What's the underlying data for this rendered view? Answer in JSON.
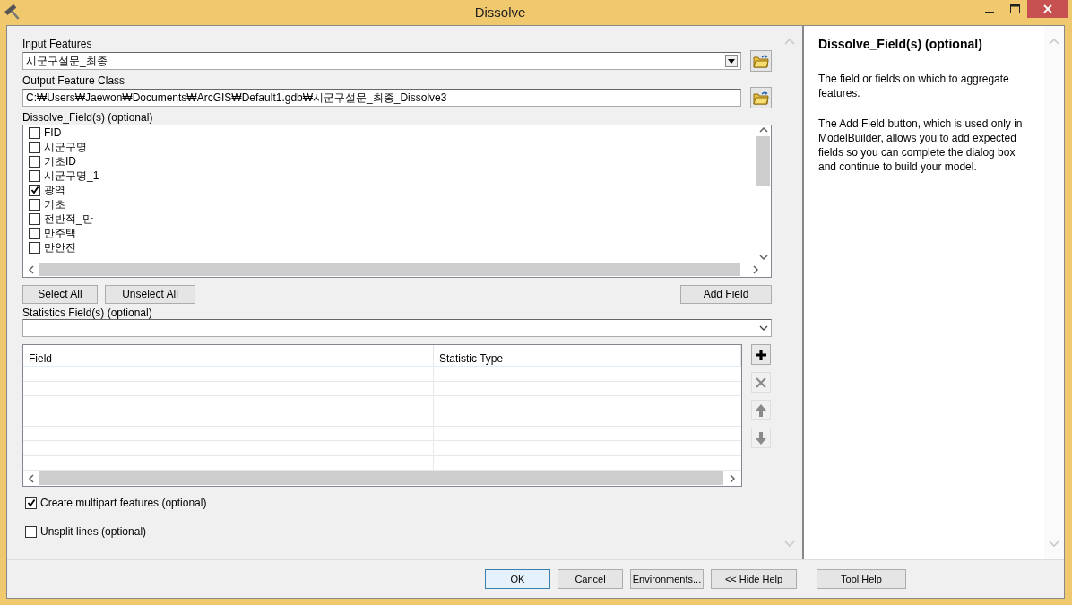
{
  "window": {
    "title": "Dissolve"
  },
  "input_features": {
    "label": "Input Features",
    "value": "시군구설문_최종"
  },
  "output_feature_class": {
    "label": "Output Feature Class",
    "value": "C:₩Users₩Jaewon₩Documents₩ArcGIS₩Default1.gdb₩시군구설문_최종_Dissolve3"
  },
  "dissolve_fields": {
    "label": "Dissolve_Field(s) (optional)",
    "items": [
      {
        "label": "FID",
        "checked": false
      },
      {
        "label": "시군구명",
        "checked": false
      },
      {
        "label": "기초ID",
        "checked": false
      },
      {
        "label": "시군구명_1",
        "checked": false
      },
      {
        "label": "광역",
        "checked": true
      },
      {
        "label": "기초",
        "checked": false
      },
      {
        "label": "전반적_만",
        "checked": false
      },
      {
        "label": "만주택",
        "checked": false
      },
      {
        "label": "만안전",
        "checked": false
      }
    ]
  },
  "list_buttons": [
    "Select All",
    "Unselect All"
  ],
  "add_field_button": "Add Field",
  "statistics_fields": {
    "label": "Statistics Field(s) (optional)",
    "columns": [
      "Field",
      "Statistic Type"
    ],
    "tools": [
      {
        "kind": "add",
        "disabled": false
      },
      {
        "kind": "remove",
        "disabled": true
      },
      {
        "kind": "up",
        "disabled": true
      },
      {
        "kind": "down",
        "disabled": true
      }
    ]
  },
  "options": [
    {
      "label": "Create multipart features (optional)",
      "checked": true
    },
    {
      "label": "Unsplit lines (optional)",
      "checked": false
    }
  ],
  "help": {
    "title": "Dissolve_Field(s) (optional)",
    "paragraphs": [
      "The field or fields on which to aggregate features.",
      "The Add Field button, which is used only in ModelBuilder, allows you to add expected fields so you can complete the dialog box and continue to build your model."
    ]
  },
  "footer_buttons": [
    {
      "label": "OK",
      "selected": true
    },
    {
      "label": "Cancel",
      "selected": false
    },
    {
      "label": "Environments...",
      "selected": false
    },
    {
      "label": "<< Hide Help",
      "selected": false
    },
    {
      "label": "Tool Help",
      "selected": false
    }
  ]
}
